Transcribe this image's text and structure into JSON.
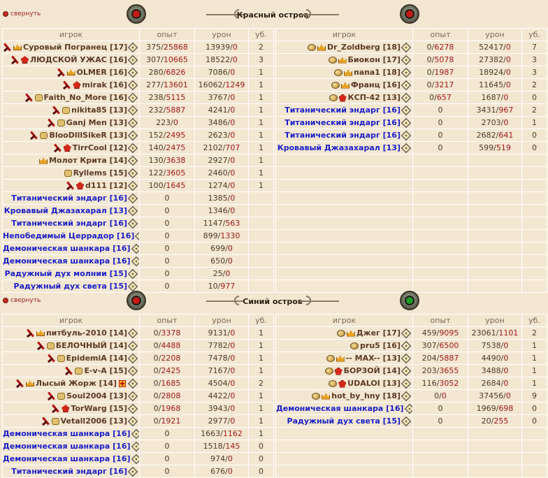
{
  "collapse_label": "свернуть",
  "headers": {
    "player": "игрок",
    "exp": "опыт",
    "dmg": "урон",
    "kills": "уб."
  },
  "colors": {
    "accent_red": "#a01818",
    "bot_blue": "#1a20c8",
    "player_brown": "#5b3a22",
    "background": "#f4e7d2"
  },
  "sections": [
    {
      "title": "Красный остров",
      "left_globe": "red-globe-icon",
      "right_globe": "red-globe-icon",
      "left_rows": [
        {
          "icons": [
            "sword-icon",
            "crown-icon"
          ],
          "name": "Суровый Погранец [17]",
          "bot": false,
          "exp_a": "375",
          "exp_b": "25868",
          "dmg_a": "13939",
          "dmg_b": "0",
          "kills": "2"
        },
        {
          "icons": [
            "sword-icon",
            "clan-icon"
          ],
          "name": "ЛЮДСКОЙ УЖАС [16]",
          "bot": false,
          "exp_a": "307",
          "exp_b": "10665",
          "dmg_a": "18522",
          "dmg_b": "0",
          "kills": "3"
        },
        {
          "icons": [
            "sword-icon",
            "crown-icon"
          ],
          "name": "OLMER [16]",
          "bot": false,
          "exp_a": "280",
          "exp_b": "6826",
          "dmg_a": "7086",
          "dmg_b": "0",
          "kills": "1"
        },
        {
          "icons": [
            "sword-icon",
            "clan-icon"
          ],
          "name": "mirak [16]",
          "bot": false,
          "exp_a": "277",
          "exp_b": "13601",
          "dmg_a": "16062",
          "dmg_b": "1249",
          "kills": "1"
        },
        {
          "icons": [
            "sword-icon",
            "shield-icon"
          ],
          "name": "Faith_No_More [16]",
          "bot": false,
          "exp_a": "238",
          "exp_b": "5115",
          "dmg_a": "3767",
          "dmg_b": "0",
          "kills": "1"
        },
        {
          "icons": [
            "sword-icon",
            "shield-icon"
          ],
          "name": "nikita85 [13]",
          "bot": false,
          "exp_a": "232",
          "exp_b": "5887",
          "dmg_a": "4241",
          "dmg_b": "0",
          "kills": "1"
        },
        {
          "icons": [
            "sword-icon",
            "shield-icon"
          ],
          "name": "Ganj Men [13]",
          "bot": false,
          "exp_a": "223",
          "exp_b": "0",
          "dmg_a": "3486",
          "dmg_b": "0",
          "kills": "1"
        },
        {
          "icons": [
            "sword-icon",
            "shield-icon"
          ],
          "name": "BlooDlllSikeR [13]",
          "bot": false,
          "exp_a": "152",
          "exp_b": "2495",
          "dmg_a": "2623",
          "dmg_b": "0",
          "kills": "1"
        },
        {
          "icons": [
            "sword-icon",
            "clan-icon"
          ],
          "name": "TirrCool [12]",
          "bot": false,
          "exp_a": "140",
          "exp_b": "2475",
          "dmg_a": "2102",
          "dmg_b": "707",
          "kills": "1"
        },
        {
          "icons": [
            "crown-icon"
          ],
          "name": "Молот Крита [14]",
          "bot": false,
          "exp_a": "130",
          "exp_b": "3638",
          "dmg_a": "2927",
          "dmg_b": "0",
          "kills": "1"
        },
        {
          "icons": [
            "shield-icon"
          ],
          "name": "Ryllems [15]",
          "bot": false,
          "exp_a": "122",
          "exp_b": "3605",
          "dmg_a": "2460",
          "dmg_b": "0",
          "kills": "1"
        },
        {
          "icons": [
            "sword-icon",
            "clan-icon"
          ],
          "name": "d111 [12]",
          "bot": false,
          "exp_a": "100",
          "exp_b": "1645",
          "dmg_a": "1274",
          "dmg_b": "0",
          "kills": "1"
        },
        {
          "icons": [],
          "name": "Титанический эндарг [16]",
          "bot": true,
          "exp_a": "0",
          "exp_b": "",
          "dmg_a": "1385",
          "dmg_b": "0",
          "kills": ""
        },
        {
          "icons": [],
          "name": "Кровавый Джазахарал [13]",
          "bot": true,
          "exp_a": "0",
          "exp_b": "",
          "dmg_a": "1346",
          "dmg_b": "0",
          "kills": ""
        },
        {
          "icons": [],
          "name": "Титанический эндарг [16]",
          "bot": true,
          "exp_a": "0",
          "exp_b": "",
          "dmg_a": "1147",
          "dmg_b": "563",
          "kills": ""
        },
        {
          "icons": [],
          "name": "Непобедимый Церрадор [16]",
          "bot": true,
          "exp_a": "0",
          "exp_b": "",
          "dmg_a": "899",
          "dmg_b": "1330",
          "kills": ""
        },
        {
          "icons": [],
          "name": "Демоническая шанкара [16]",
          "bot": true,
          "exp_a": "0",
          "exp_b": "",
          "dmg_a": "699",
          "dmg_b": "0",
          "kills": ""
        },
        {
          "icons": [],
          "name": "Демоническая шанкара [16]",
          "bot": true,
          "exp_a": "0",
          "exp_b": "",
          "dmg_a": "650",
          "dmg_b": "0",
          "kills": ""
        },
        {
          "icons": [],
          "name": "Радужный дух молнии [15]",
          "bot": true,
          "exp_a": "0",
          "exp_b": "",
          "dmg_a": "25",
          "dmg_b": "0",
          "kills": ""
        },
        {
          "icons": [],
          "name": "Радужный дух света [15]",
          "bot": true,
          "exp_a": "0",
          "exp_b": "",
          "dmg_a": "10",
          "dmg_b": "977",
          "kills": ""
        }
      ],
      "right_rows": [
        {
          "icons": [
            "pig-icon",
            "crown-icon"
          ],
          "name": "Dr_Zoldberg [18]",
          "bot": false,
          "exp_a": "0",
          "exp_b": "6278",
          "dmg_a": "52417",
          "dmg_b": "0",
          "kills": "7"
        },
        {
          "icons": [
            "pig-icon",
            "crown-icon"
          ],
          "name": "Биокон [17]",
          "bot": false,
          "exp_a": "0",
          "exp_b": "5078",
          "dmg_a": "27382",
          "dmg_b": "0",
          "kills": "3"
        },
        {
          "icons": [
            "pig-icon",
            "crown-icon"
          ],
          "name": "папа1 [18]",
          "bot": false,
          "exp_a": "0",
          "exp_b": "1987",
          "dmg_a": "18924",
          "dmg_b": "0",
          "kills": "3"
        },
        {
          "icons": [
            "pig-icon",
            "crown-icon"
          ],
          "name": "Франц [16]",
          "bot": false,
          "exp_a": "0",
          "exp_b": "3217",
          "dmg_a": "11645",
          "dmg_b": "0",
          "kills": "2"
        },
        {
          "icons": [
            "pig-icon",
            "clan-icon"
          ],
          "name": "КСП-42 [13]",
          "bot": false,
          "exp_a": "0",
          "exp_b": "657",
          "dmg_a": "1687",
          "dmg_b": "0",
          "kills": "0"
        },
        {
          "icons": [],
          "name": "Титанический эндарг [16]",
          "bot": true,
          "exp_a": "0",
          "exp_b": "",
          "dmg_a": "3431",
          "dmg_b": "967",
          "kills": "2"
        },
        {
          "icons": [],
          "name": "Титанический эндарг [16]",
          "bot": true,
          "exp_a": "0",
          "exp_b": "",
          "dmg_a": "2703",
          "dmg_b": "0",
          "kills": "1"
        },
        {
          "icons": [],
          "name": "Титанический эндарг [16]",
          "bot": true,
          "exp_a": "0",
          "exp_b": "",
          "dmg_a": "2682",
          "dmg_b": "641",
          "kills": "0"
        },
        {
          "icons": [],
          "name": "Кровавый Джазахарал [13]",
          "bot": true,
          "exp_a": "0",
          "exp_b": "",
          "dmg_a": "599",
          "dmg_b": "519",
          "kills": "0"
        }
      ]
    },
    {
      "title": "Синий остров",
      "left_globe": "red-globe-icon",
      "right_globe": "green-globe-icon",
      "left_rows": [
        {
          "icons": [
            "sword-icon",
            "crown-icon"
          ],
          "name": "питбуль-2010 [14]",
          "bot": false,
          "exp_a": "0",
          "exp_b": "3378",
          "dmg_a": "9131",
          "dmg_b": "0",
          "kills": "1"
        },
        {
          "icons": [
            "sword-icon",
            "shield-icon"
          ],
          "name": "БЕЛОЧНЫЙ [14]",
          "bot": false,
          "exp_a": "0",
          "exp_b": "4488",
          "dmg_a": "7782",
          "dmg_b": "0",
          "kills": "1"
        },
        {
          "icons": [
            "sword-icon",
            "shield-icon"
          ],
          "name": "EpidemiA [14]",
          "bot": false,
          "exp_a": "0",
          "exp_b": "2208",
          "dmg_a": "7478",
          "dmg_b": "0",
          "kills": "1"
        },
        {
          "icons": [
            "sword-icon",
            "shield-icon"
          ],
          "name": "E-v-A [15]",
          "bot": false,
          "exp_a": "0",
          "exp_b": "2425",
          "dmg_a": "7167",
          "dmg_b": "0",
          "kills": "1"
        },
        {
          "icons": [
            "sword-icon",
            "crown-icon"
          ],
          "name": "Лысый Жорж [14]",
          "bot": false,
          "exp_a": "0",
          "exp_b": "1685",
          "dmg_a": "4504",
          "dmg_b": "0",
          "kills": "2",
          "extra": "plus-badge-icon"
        },
        {
          "icons": [
            "sword-icon",
            "shield-icon"
          ],
          "name": "Soul2004 [13]",
          "bot": false,
          "exp_a": "0",
          "exp_b": "2808",
          "dmg_a": "4422",
          "dmg_b": "0",
          "kills": "1"
        },
        {
          "icons": [
            "sword-icon",
            "clan-icon"
          ],
          "name": "TorWarg [15]",
          "bot": false,
          "exp_a": "0",
          "exp_b": "1968",
          "dmg_a": "3943",
          "dmg_b": "0",
          "kills": "1"
        },
        {
          "icons": [
            "sword-icon",
            "shield-icon"
          ],
          "name": "Vetall2006 [13]",
          "bot": false,
          "exp_a": "0",
          "exp_b": "1921",
          "dmg_a": "2977",
          "dmg_b": "0",
          "kills": "1"
        },
        {
          "icons": [],
          "name": "Демоническая шанкара [16]",
          "bot": true,
          "exp_a": "0",
          "exp_b": "",
          "dmg_a": "1663",
          "dmg_b": "1162",
          "kills": "1"
        },
        {
          "icons": [],
          "name": "Демоническая шанкара [16]",
          "bot": true,
          "exp_a": "0",
          "exp_b": "",
          "dmg_a": "1518",
          "dmg_b": "145",
          "kills": "0"
        },
        {
          "icons": [],
          "name": "Демоническая шанкара [16]",
          "bot": true,
          "exp_a": "0",
          "exp_b": "",
          "dmg_a": "974",
          "dmg_b": "0",
          "kills": "0"
        },
        {
          "icons": [],
          "name": "Титанический эндарг [16]",
          "bot": true,
          "exp_a": "0",
          "exp_b": "",
          "dmg_a": "676",
          "dmg_b": "0",
          "kills": "0"
        }
      ],
      "right_rows": [
        {
          "icons": [
            "pig-icon",
            "crown-icon"
          ],
          "name": "Джег [17]",
          "bot": false,
          "exp_a": "459",
          "exp_b": "9095",
          "dmg_a": "23061",
          "dmg_b": "1101",
          "kills": "2"
        },
        {
          "icons": [
            "pig-icon"
          ],
          "name": "pru5 [16]",
          "bot": false,
          "exp_a": "307",
          "exp_b": "6500",
          "dmg_a": "7538",
          "dmg_b": "0",
          "kills": "1"
        },
        {
          "icons": [
            "pig-icon",
            "crown-icon"
          ],
          "name": "-- MAX-- [13]",
          "bot": false,
          "exp_a": "204",
          "exp_b": "5887",
          "dmg_a": "4490",
          "dmg_b": "0",
          "kills": "1"
        },
        {
          "icons": [
            "pig-icon",
            "clan-icon"
          ],
          "name": "БОРЗОЙ [14]",
          "bot": false,
          "exp_a": "203",
          "exp_b": "3655",
          "dmg_a": "3488",
          "dmg_b": "0",
          "kills": "1"
        },
        {
          "icons": [
            "pig-icon",
            "clan-icon"
          ],
          "name": "UDALOI [13]",
          "bot": false,
          "exp_a": "116",
          "exp_b": "3052",
          "dmg_a": "2684",
          "dmg_b": "0",
          "kills": "1"
        },
        {
          "icons": [
            "pig-icon",
            "crown-icon"
          ],
          "name": "hot_by_hny [18]",
          "bot": false,
          "exp_a": "0",
          "exp_b": "0",
          "dmg_a": "37456",
          "dmg_b": "0",
          "kills": "9"
        },
        {
          "icons": [],
          "name": "Демоническая шанкара [16]",
          "bot": true,
          "exp_a": "0",
          "exp_b": "",
          "dmg_a": "1969",
          "dmg_b": "698",
          "kills": "0"
        },
        {
          "icons": [],
          "name": "Радужный дух света [15]",
          "bot": true,
          "exp_a": "0",
          "exp_b": "",
          "dmg_a": "20",
          "dmg_b": "255",
          "kills": "0"
        }
      ]
    }
  ]
}
